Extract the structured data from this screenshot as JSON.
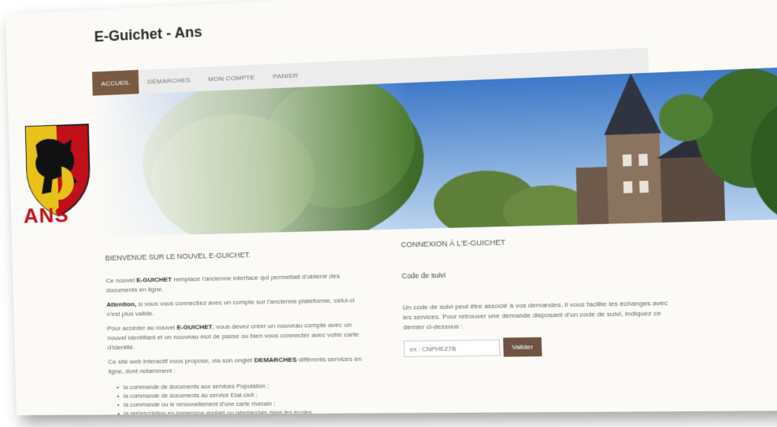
{
  "site": {
    "title": "E-Guichet - Ans"
  },
  "nav": {
    "items": [
      {
        "label": "ACCUEIL",
        "active": true
      },
      {
        "label": "DÉMARCHES",
        "active": false
      },
      {
        "label": "MON COMPTE",
        "active": false
      },
      {
        "label": "PANIER",
        "active": false
      }
    ]
  },
  "logo": {
    "text": "ANS",
    "icon": "lion-coat-of-arms-icon",
    "colors": {
      "red": "#c0101a",
      "gold": "#e8c21a",
      "black": "#111111"
    }
  },
  "welcome": {
    "title": "BIENVENUE SUR LE NOUVEL E-GUICHET.",
    "p1_pre": "Ce nouvel ",
    "p1_bold": "E-GUICHET",
    "p1_post": " remplace l'ancienne interface qui permettait d'obtenir des documents en ligne.",
    "p2_bold": "Attention,",
    "p2_post": " si vous vous connectiez avec un compte sur l'ancienne plateforme, celui-ci n'est plus valide.",
    "p3_pre": "Pour accéder au nouvel ",
    "p3_bold": "E-GUICHET",
    "p3_post": ", vous devez créer un nouveau compte avec un nouvel identifiant et un nouveau mot de passe ou bien vous connecter avec votre carte d'identité.",
    "p4_pre": "Ce site web interactif vous propose, via son onglet ",
    "p4_bold": "DEMARCHES",
    "p4_post": " différents services en ligne, dont notamment :",
    "bullets": [
      "la commande de documents aux services Population ;",
      "la commande de documents au service Etat-civil ;",
      "la commande ou le renouvellement d'une carte riverain ;",
      "la préinscription en immersion anglais ou néerlandais dans les écoles"
    ]
  },
  "login": {
    "title": "CONNEXION À L'E-GUICHET",
    "code_label": "Code de suivi",
    "desc": "Un code de suivi peut être associé à vos demandes, il vous facilite les échanges avec les services. Pour retrouver une demande disposant d'un code de suivi, indiquez ce dernier ci-dessous :",
    "input_placeholder": "ex : CNPHEZ7B",
    "button_label": "Valider",
    "accent": "#6f5242"
  }
}
